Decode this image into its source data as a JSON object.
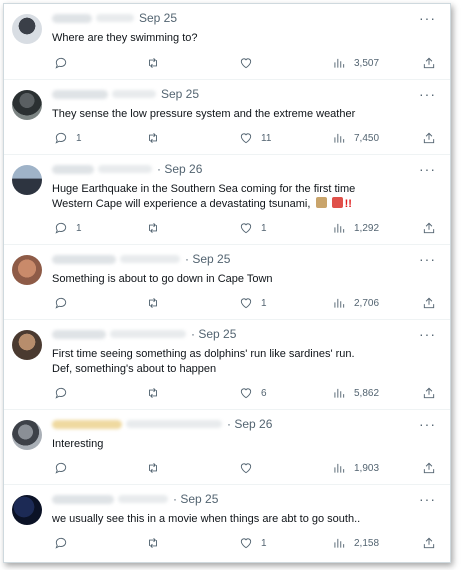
{
  "tweets": [
    {
      "date": "Sep 25",
      "text": "Where are they swimming to?",
      "replies": "",
      "retweets": "",
      "likes": "",
      "views": "3,507"
    },
    {
      "date": "Sep 25",
      "text": "They sense the low pressure system and the extreme weather",
      "replies": "1",
      "retweets": "",
      "likes": "11",
      "views": "7,450"
    },
    {
      "date": "· Sep 26",
      "text": "Huge Earthquake in the Southern Sea coming for the first time Western Cape will experience a devastating tsunami,",
      "emoji_text": "!!",
      "replies": "1",
      "retweets": "",
      "likes": "1",
      "views": "1,292"
    },
    {
      "date": "· Sep 25",
      "text": "Something is about to go down in Cape Town",
      "replies": "",
      "retweets": "",
      "likes": "1",
      "views": "2,706"
    },
    {
      "date": "· Sep 25",
      "text": "First time seeing something as dolphins' run like sardines' run. Def, something's about to happen",
      "replies": "",
      "retweets": "",
      "likes": "6",
      "views": "5,862"
    },
    {
      "date": "· Sep 26",
      "text": "Interesting",
      "replies": "",
      "retweets": "",
      "likes": "",
      "views": "1,903"
    },
    {
      "date": "· Sep 25",
      "text": "we usually see this in a movie when things are abt to go south..",
      "replies": "",
      "retweets": "",
      "likes": "1",
      "views": "2,158"
    }
  ],
  "icons": {
    "reply": "reply-icon",
    "retweet": "retweet-icon",
    "like": "heart-icon",
    "views": "views-chart-icon",
    "share": "share-icon",
    "more": "more-dots-icon"
  },
  "colors": {
    "text": "#0f1419",
    "muted": "#536471",
    "border": "#eff3f4"
  },
  "more_label": "···"
}
